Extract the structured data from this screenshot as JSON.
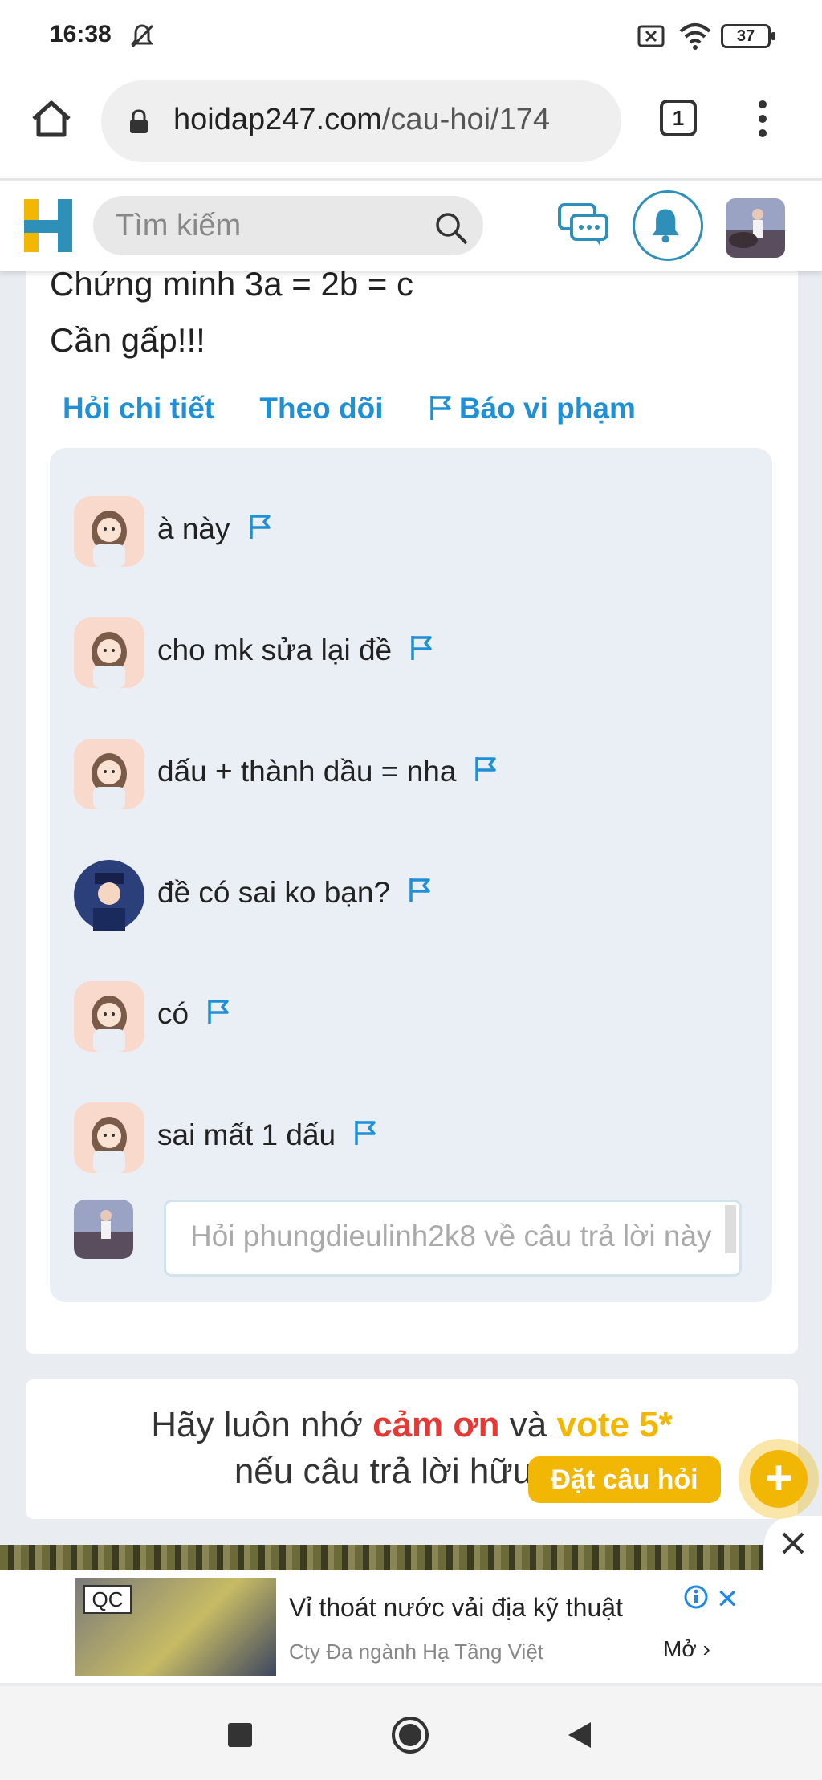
{
  "status_bar": {
    "time": "16:38",
    "battery": "37",
    "icons": [
      "bell-off-icon",
      "sim-off-icon",
      "wifi-icon",
      "battery-icon"
    ]
  },
  "browser": {
    "url_domain": "hoidap247.com",
    "url_path": "/cau-hoi/174",
    "tab_count": "1",
    "icons": [
      "home-icon",
      "lock-icon",
      "tabs-icon",
      "more-vert-icon"
    ]
  },
  "site_header": {
    "logo_letter": "H",
    "search_placeholder": "Tìm kiếm",
    "icons": [
      "search-icon",
      "chat-icon",
      "bell-icon",
      "avatar"
    ]
  },
  "question": {
    "line1": "Chứng minh 3a = 2b = c",
    "line2": "Cần gấp!!!",
    "actions": {
      "detail": "Hỏi chi tiết",
      "follow": "Theo dõi",
      "report": "Báo vi phạm"
    }
  },
  "comments": [
    {
      "text": "à này",
      "avatar": "girl"
    },
    {
      "text": "cho mk sửa lại đề",
      "avatar": "girl"
    },
    {
      "text": "dấu + thành dầu = nha",
      "avatar": "girl"
    },
    {
      "text": "đề có sai ko bạn?",
      "avatar": "boy"
    },
    {
      "text": "có",
      "avatar": "girl"
    },
    {
      "text": "sai mất 1 dấu",
      "avatar": "girl"
    }
  ],
  "reply": {
    "placeholder": "Hỏi phungdieulinh2k8 về câu trả lời này"
  },
  "thanks": {
    "prefix": "Hãy luôn nhớ ",
    "thanks_word": "cảm ơn",
    "middle": " và ",
    "vote_word": "vote 5*",
    "line2": "nếu câu trả lời hữu ích"
  },
  "ask_button": {
    "label": "Đặt câu hỏi",
    "plus": "+"
  },
  "ad": {
    "badge": "QC",
    "title": "Vỉ thoát nước vải địa kỹ thuật",
    "advertiser": "Cty Đa ngành Hạ Tầng Việt",
    "open": "Mở",
    "close": "✕"
  },
  "colors": {
    "link_blue": "#1f8fd6",
    "accent_yellow": "#f2b705",
    "accent_red": "#e53935",
    "comment_bg": "#eaeff5",
    "page_bg": "#e9edf2"
  }
}
